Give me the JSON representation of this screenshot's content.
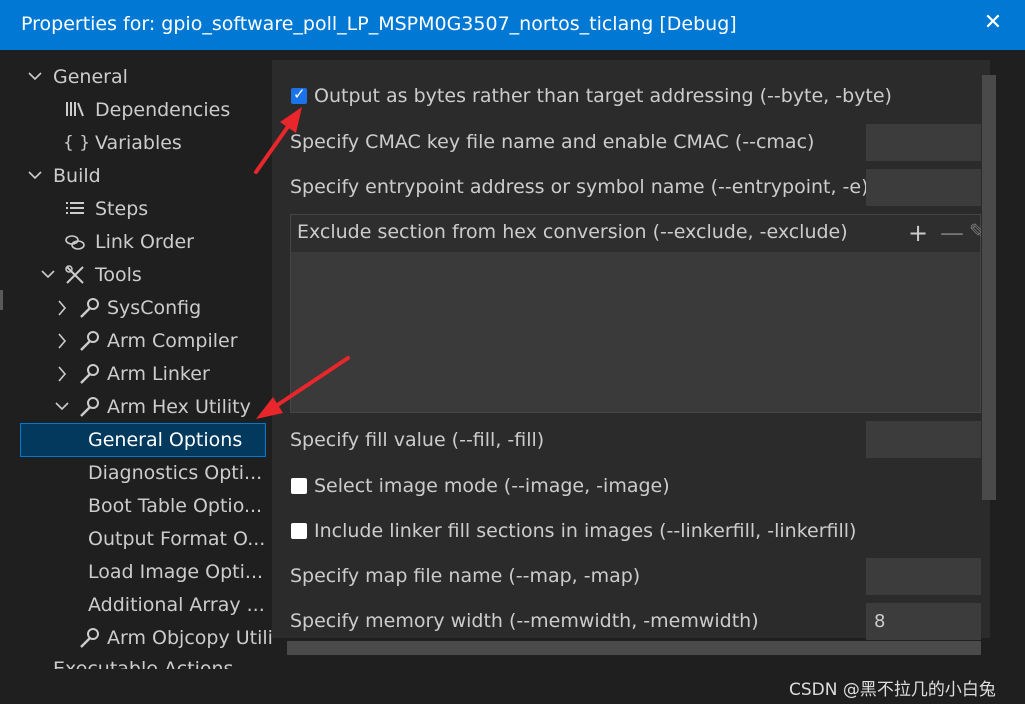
{
  "window": {
    "title": "Properties for: gpio_software_poll_LP_MSPM0G3507_nortos_ticlang [Debug]",
    "close_glyph": "✕"
  },
  "tree": {
    "items": [
      {
        "label": "General",
        "chevron": "open"
      },
      {
        "label": "Dependencies",
        "icon": "library-icon"
      },
      {
        "label": "Variables",
        "icon": "braces-icon"
      },
      {
        "label": "Build",
        "chevron": "open"
      },
      {
        "label": "Steps",
        "icon": "list-icon"
      },
      {
        "label": "Link Order",
        "icon": "link-icon"
      },
      {
        "label": "Tools",
        "chevron": "open",
        "icon": "tools-icon"
      },
      {
        "label": "SysConfig",
        "chevron": "closed",
        "icon": "wrench-icon"
      },
      {
        "label": "Arm Compiler",
        "chevron": "closed",
        "icon": "wrench-icon"
      },
      {
        "label": "Arm Linker",
        "chevron": "closed",
        "icon": "wrench-icon"
      },
      {
        "label": "Arm Hex Utility",
        "chevron": "open",
        "icon": "wrench-icon"
      },
      {
        "label": "General Options",
        "selected": true
      },
      {
        "label": "Diagnostics Opti..."
      },
      {
        "label": "Boot Table Optio..."
      },
      {
        "label": "Output Format O..."
      },
      {
        "label": "Load Image Opti..."
      },
      {
        "label": "Additional Array ..."
      },
      {
        "label": "Arm Objcopy Utilit",
        "icon": "wrench-icon"
      },
      {
        "label": "Executable Actions"
      }
    ]
  },
  "options": {
    "byte_label": "Output as bytes rather than target addressing (--byte, -byte)",
    "byte_checked": true,
    "cmac_label": "Specify CMAC key file name and enable CMAC (--cmac)",
    "cmac_value": "",
    "entry_label": "Specify entrypoint address or symbol name (--entrypoint, -e)",
    "entry_value": "",
    "exclude_label": "Exclude section from hex conversion (--exclude, -exclude)",
    "exclude_add": "+",
    "exclude_remove": "—",
    "exclude_edit": "✎",
    "fill_label": "Specify fill value (--fill, -fill)",
    "fill_value": "",
    "image_label": "Select image mode (--image, -image)",
    "image_checked": false,
    "linkerfill_label": "Include linker fill sections in images (--linkerfill, -linkerfill)",
    "linkerfill_checked": false,
    "map_label": "Specify map file name (--map, -map)",
    "map_value": "",
    "memwidth_label": "Specify memory width (--memwidth, -memwidth)",
    "memwidth_value": "8"
  },
  "watermark": "CSDN @黑不拉几的小白兔",
  "colors": {
    "titlebar": "#0078d4",
    "selection": "#04395e",
    "annotation_arrow": "#e8262b"
  }
}
